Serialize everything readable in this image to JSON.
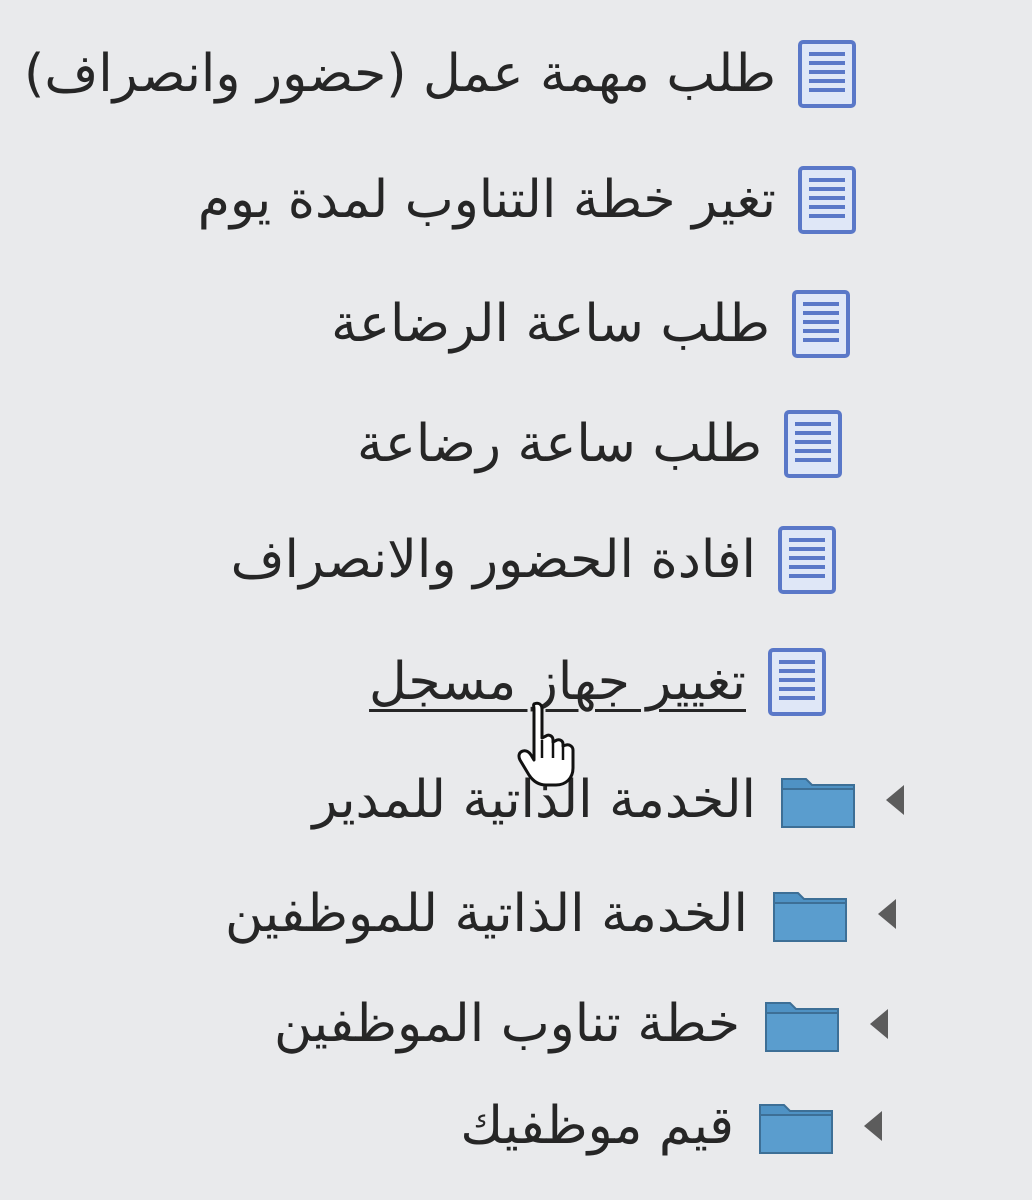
{
  "tree": {
    "items": [
      {
        "type": "document",
        "label": "طلب مهمة عمل (حضور وانصراف)"
      },
      {
        "type": "document",
        "label": "تغير خطة التناوب لمدة يوم"
      },
      {
        "type": "document",
        "label": "طلب ساعة الرضاعة"
      },
      {
        "type": "document",
        "label": "طلب ساعة رضاعة"
      },
      {
        "type": "document",
        "label": "افادة الحضور والانصراف"
      },
      {
        "type": "document",
        "label": "تغيير جهاز مسجل",
        "hovered": true
      },
      {
        "type": "folder",
        "label": "الخدمة الذاتية للمدير",
        "expanded": false
      },
      {
        "type": "folder",
        "label": "الخدمة الذاتية للموظفين",
        "expanded": false
      },
      {
        "type": "folder",
        "label": "خطة تناوب الموظفين",
        "expanded": false
      },
      {
        "type": "folder",
        "label": "قيم موظفيك",
        "expanded": false
      }
    ]
  },
  "icons": {
    "document": "document-icon",
    "folder": "folder-icon",
    "expander": "collapsed-arrow-icon",
    "cursor": "hand-pointer-cursor-icon"
  },
  "colors": {
    "background": "#e9eaec",
    "document_border": "#5a78c8",
    "document_fill": "#dfe7f7",
    "folder_fill": "#4f92c4",
    "arrow": "#5c5c5c",
    "text": "#262626"
  }
}
